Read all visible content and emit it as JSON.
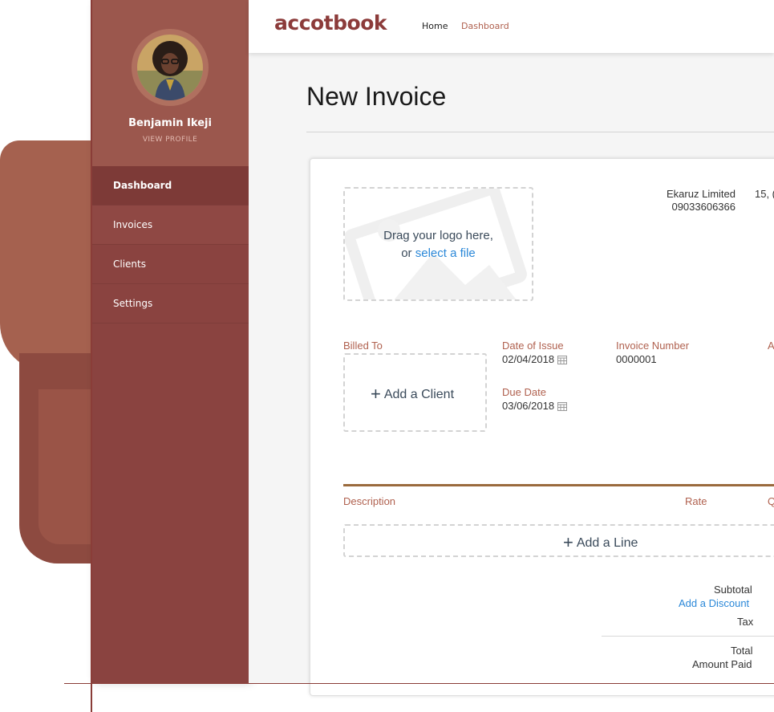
{
  "user": {
    "name": "Benjamin Ikeji",
    "profile_link": "VIEW PROFILE"
  },
  "sidebar": {
    "items": [
      {
        "label": "Dashboard",
        "active": true
      },
      {
        "label": "Invoices"
      },
      {
        "label": "Clients"
      },
      {
        "label": "Settings"
      }
    ]
  },
  "brand": {
    "logo": "accotbook",
    "color": "#8c3b3a"
  },
  "topnav": {
    "home": "Home",
    "dashboard": "Dashboard"
  },
  "page": {
    "title": "New Invoice"
  },
  "invoice": {
    "logo_drop": {
      "line1": "Drag your logo here,",
      "line2_prefix": "or ",
      "line2_link": "select a file"
    },
    "company": {
      "name": "Ekaruz Limited",
      "phone": "09033606366",
      "address": "15, ("
    },
    "billed_to_label": "Billed To",
    "add_client": "Add a Client",
    "date_of_issue_label": "Date of Issue",
    "date_of_issue": "02/04/2018",
    "due_date_label": "Due Date",
    "due_date": "03/06/2018",
    "invoice_number_label": "Invoice Number",
    "invoice_number": "0000001",
    "amount_label_partial": "A",
    "columns": {
      "description": "Description",
      "rate": "Rate",
      "qty_partial": "Q"
    },
    "add_line": "Add a Line",
    "totals": {
      "subtotal": "Subtotal",
      "add_discount": "Add a Discount",
      "tax": "Tax",
      "total": "Total",
      "amount_paid": "Amount Paid"
    }
  },
  "colors": {
    "sidebar": "#8a4340",
    "accent_label": "#b0614f",
    "link": "#2b88d8"
  }
}
